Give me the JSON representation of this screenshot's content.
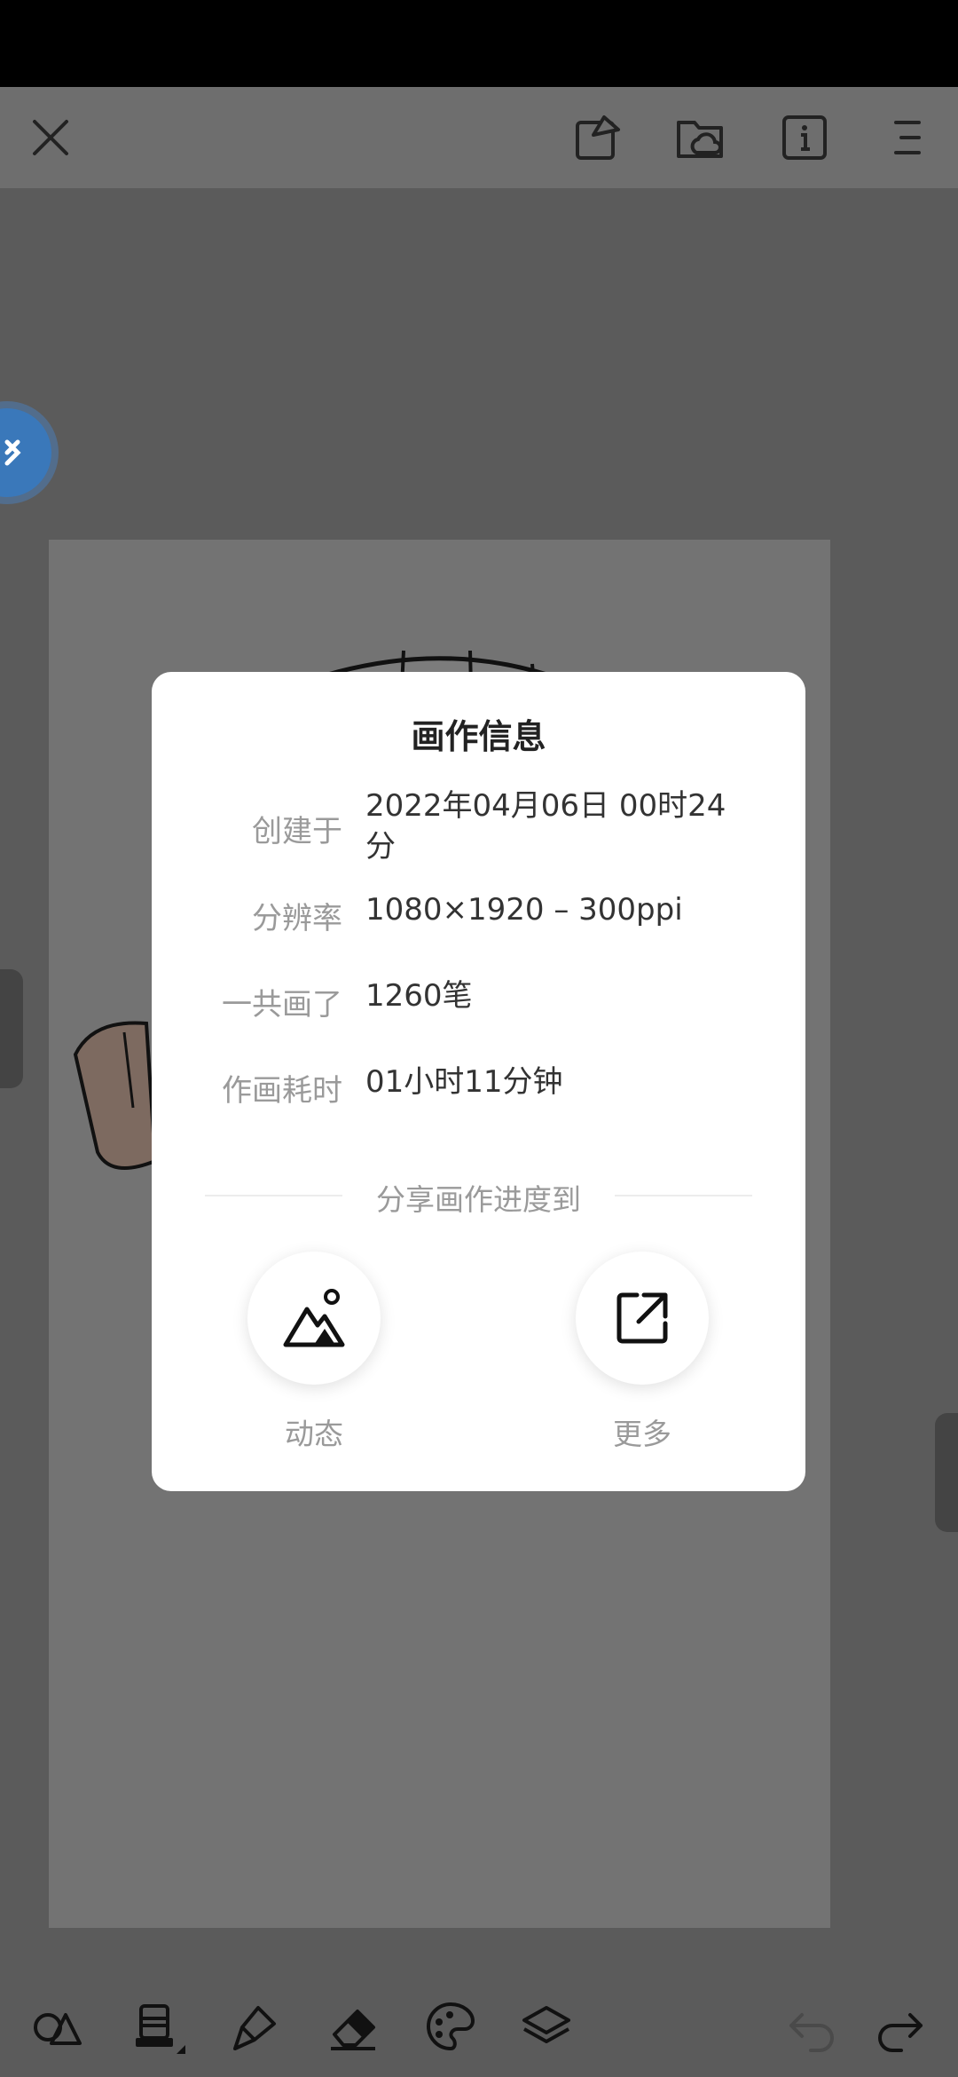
{
  "dialog": {
    "title": "画作信息",
    "rows": [
      {
        "label": "创建于",
        "value": "2022年04月06日 00时24分"
      },
      {
        "label": "分辨率",
        "value": "1080×1920 – 300ppi"
      },
      {
        "label": "一共画了",
        "value": "1260笔"
      },
      {
        "label": "作画耗时",
        "value": "01小时11分钟"
      }
    ],
    "share_label": "分享画作进度到",
    "share_buttons": [
      {
        "icon": "mountain-image-icon",
        "label": "动态"
      },
      {
        "icon": "external-link-icon",
        "label": "更多"
      }
    ]
  },
  "topbar_icons": [
    "close-icon",
    "shapes-icon",
    "cloud-folder-icon",
    "info-icon",
    "menu-icon"
  ],
  "bottombar_icons": [
    "shapes-tool-icon",
    "brush-stamp-icon",
    "pen-icon",
    "eraser-icon",
    "palette-icon",
    "layers-icon",
    "undo-icon",
    "redo-icon"
  ],
  "colors": {
    "dialog_bg": "#ffffff",
    "overlay": "#5b5b5b",
    "fab_blue": "#3a78ba"
  }
}
